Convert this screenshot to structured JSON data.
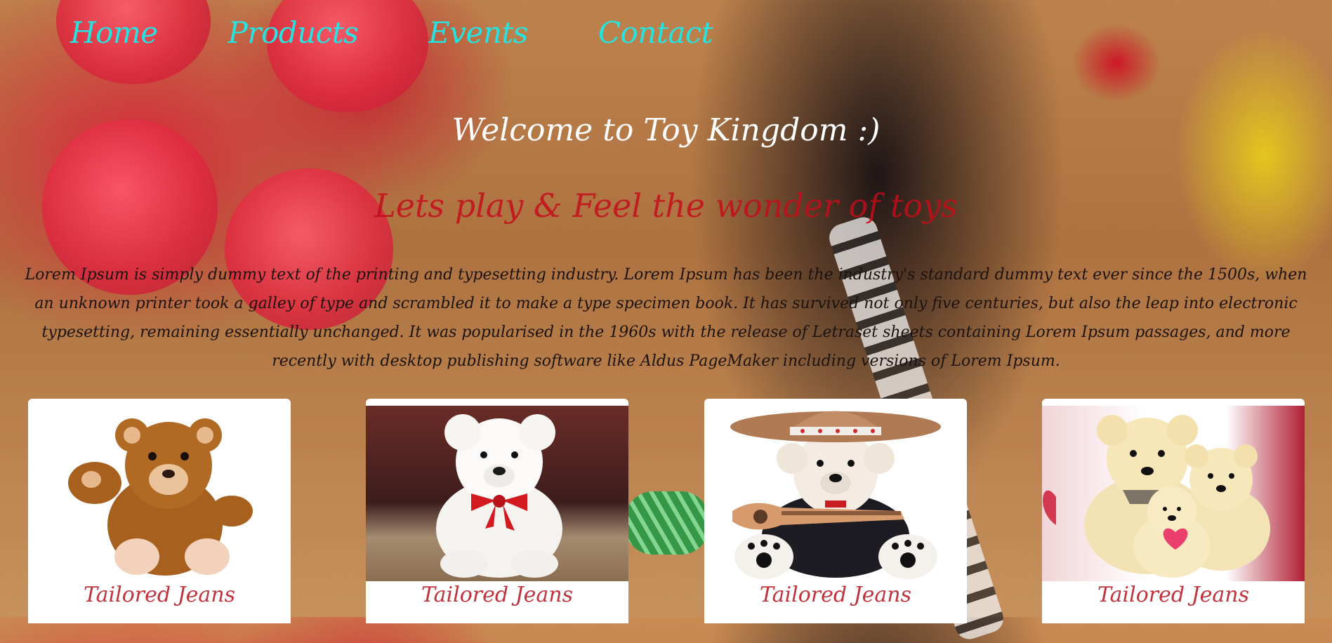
{
  "nav": {
    "items": [
      {
        "label": "Home"
      },
      {
        "label": "Products"
      },
      {
        "label": "Events"
      },
      {
        "label": "Contact"
      }
    ]
  },
  "hero": {
    "title": "Welcome to Toy Kingdom :)",
    "subtitle": "Lets play & Feel the wonder of toys",
    "intro": "Lorem Ipsum is simply dummy text of the printing and typesetting industry. Lorem Ipsum has been the industry's standard dummy text ever since the 1500s, when an unknown printer took a galley of type and scrambled it to make a type specimen book. It has survived not only five centuries, but also the leap into electronic typesetting, remaining essentially unchanged. It was popularised in the 1960s with the release of Letraset sheets containing Lorem Ipsum passages, and more recently with desktop publishing software like Aldus PageMaker including versions of Lorem Ipsum."
  },
  "products": [
    {
      "caption": "Tailored Jeans",
      "image": "brown-teddy-bear-waving"
    },
    {
      "caption": "Tailored Jeans",
      "image": "white-teddy-bear-red-bow"
    },
    {
      "caption": "Tailored Jeans",
      "image": "teddy-bear-cowboy-hat-guitar"
    },
    {
      "caption": "Tailored Jeans",
      "image": "cream-teddy-bear-family"
    }
  ],
  "colors": {
    "nav_link": "#25e3e0",
    "title": "#ffffff",
    "subtitle": "#c40d1a",
    "caption": "#c0323c"
  }
}
